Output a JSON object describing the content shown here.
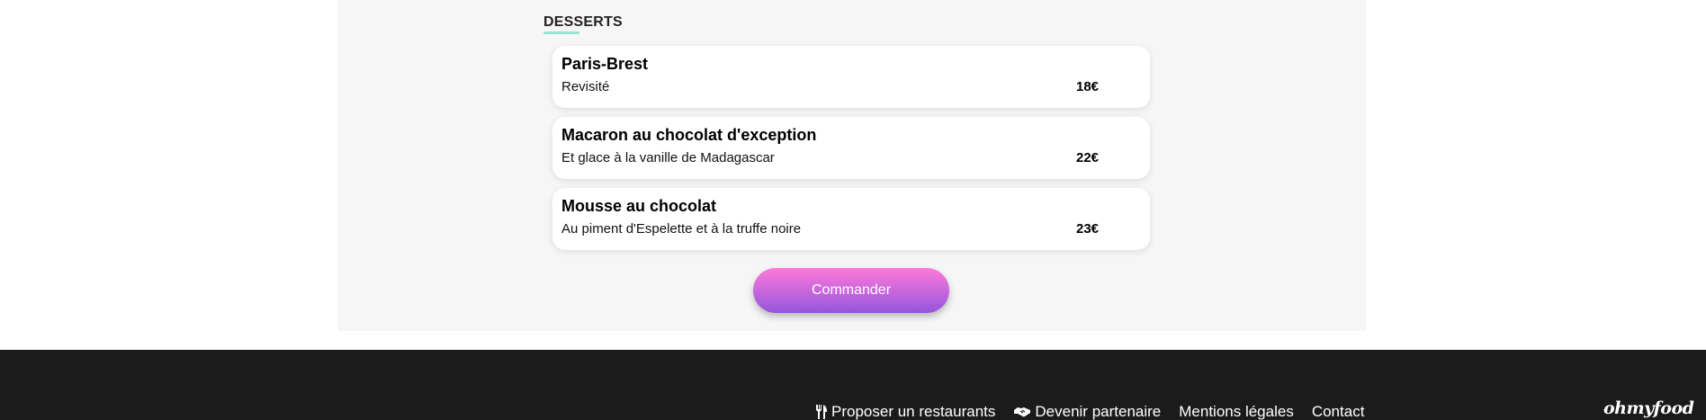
{
  "section": {
    "title": "DESSERTS"
  },
  "dishes": [
    {
      "name": "Paris-Brest",
      "description": "Revisité",
      "price": "18€"
    },
    {
      "name": "Macaron au chocolat d'exception",
      "description": "Et glace à la vanille de Madagascar",
      "price": "22€"
    },
    {
      "name": "Mousse au chocolat",
      "description": "Au piment d'Espelette et à la truffe noire",
      "price": "23€"
    }
  ],
  "order_button": {
    "label": "Commander"
  },
  "footer": {
    "links": [
      {
        "label": "Proposer un restaurants",
        "icon": "utensils-icon"
      },
      {
        "label": "Devenir partenaire",
        "icon": "handshake-icon"
      },
      {
        "label": "Mentions légales"
      },
      {
        "label": "Contact"
      }
    ],
    "brand": "ohmyfood"
  },
  "colors": {
    "accent_underline": "#99e2d0",
    "button_gradient_top": "#ff79da",
    "button_gradient_bottom": "#9356dc",
    "footer_bg": "#1b1b1b",
    "panel_bg": "#f6f6f6"
  }
}
